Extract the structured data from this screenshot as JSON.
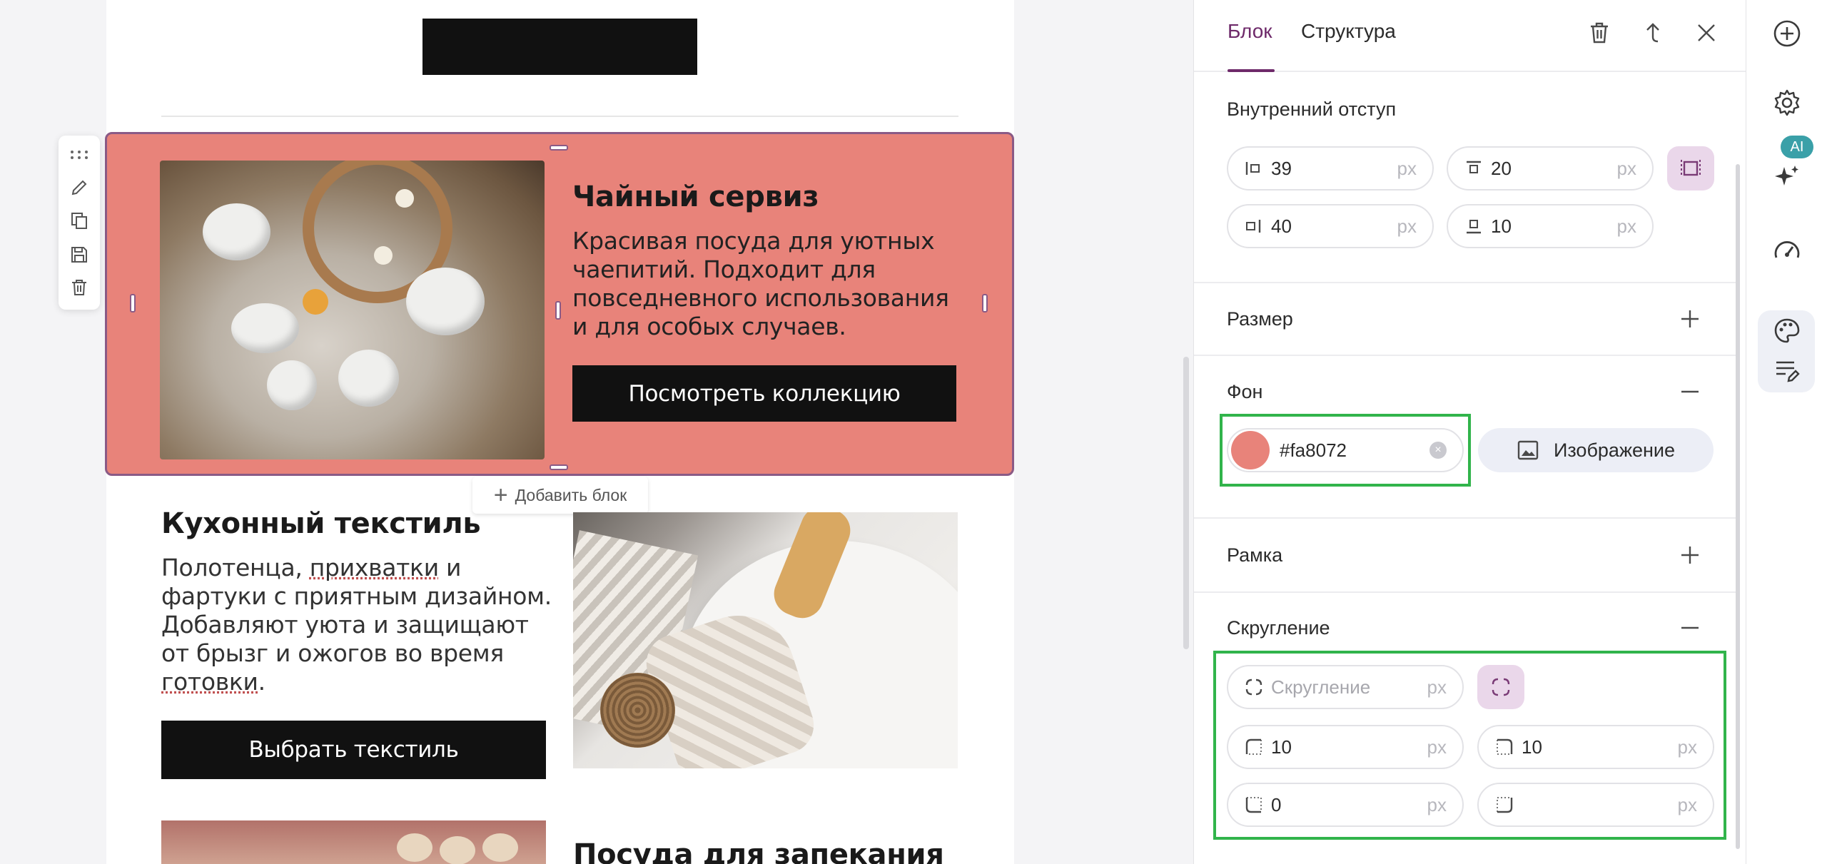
{
  "canvas": {
    "block1": {
      "title": "Чайный сервиз",
      "text": "Красивая посуда для уютных чаепитий. Подходит для повседневного использования и для особых случаев.",
      "button": "Посмотреть коллекцию"
    },
    "add_block_label": "Добавить блок",
    "block2": {
      "title": "Кухонный текстиль",
      "text_before": "Полотенца, ",
      "text_link": "прихватки",
      "text_mid": " и фартуки с приятным дизайном. Добавляют уюта и защищают от брызг и ожогов во время ",
      "text_link2": "готовки",
      "text_after": ".",
      "button": "Выбрать текстиль"
    },
    "block3": {
      "title": "Посуда для запекания"
    }
  },
  "panel": {
    "tabs": [
      {
        "label": "Блок",
        "active": true
      },
      {
        "label": "Структура",
        "active": false
      }
    ],
    "padding": {
      "title": "Внутренний отступ",
      "left": "39",
      "top": "20",
      "right": "40",
      "bottom": "10",
      "unit": "px"
    },
    "size": {
      "title": "Размер"
    },
    "background": {
      "title": "Фон",
      "color_value": "#fa8072",
      "image_button": "Изображение"
    },
    "border": {
      "title": "Рамка"
    },
    "radius": {
      "title": "Скругление",
      "all_placeholder": "Скругление",
      "top_left": "10",
      "top_right": "10",
      "bottom_left": "0",
      "bottom_right": "",
      "unit": "px"
    }
  },
  "rail": {
    "ai_badge": "AI"
  },
  "colors": {
    "accent": "#6e2a6a",
    "block_bg": "#fa8072",
    "highlight": "#31b44b",
    "icon_gray": "#4a4a4a"
  }
}
